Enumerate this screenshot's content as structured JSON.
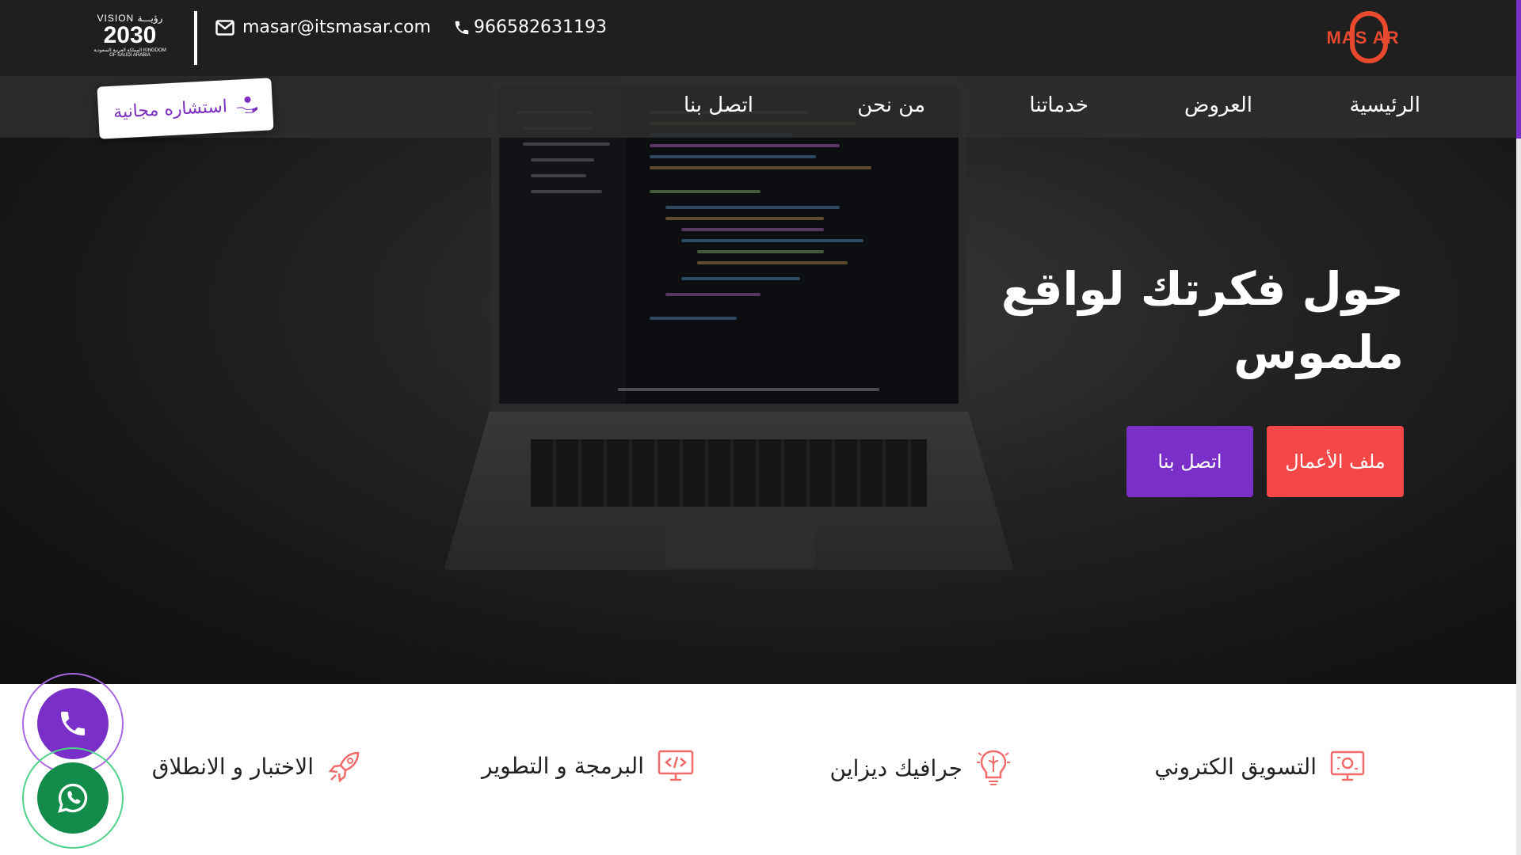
{
  "header": {
    "logo_text": "MAS AR",
    "phone": "966582631193",
    "email": "masar@itsmasar.com",
    "vision": {
      "line1": "VISION رؤيـــة",
      "line2": "2030",
      "line3": "المملكة العربية السعودية KINGDOM OF SAUDI ARABIA"
    }
  },
  "nav": {
    "items": [
      {
        "label": "الرئيسية"
      },
      {
        "label": "العروض"
      },
      {
        "label": "خدماتنا"
      },
      {
        "label": "من نحن"
      },
      {
        "label": "اتصل بنا"
      }
    ],
    "consult_label": "استشاره مجانية"
  },
  "hero": {
    "title": "حول فكرتك لواقع ملموس",
    "buttons": {
      "portfolio": "ملف الأعمال",
      "contact": "اتصل بنا"
    }
  },
  "services": [
    {
      "label": "التسويق الكتروني",
      "icon": "marketing-monitor-icon"
    },
    {
      "label": "جرافيك ديزاين",
      "icon": "brain-bulb-icon"
    },
    {
      "label": "البرمجة و التطوير",
      "icon": "code-monitor-icon"
    },
    {
      "label": "الاختبار و الانطلاق",
      "icon": "rocket-icon"
    }
  ],
  "floating": {
    "call_icon": "phone-icon",
    "whatsapp_icon": "whatsapp-icon"
  },
  "colors": {
    "accent": "#7a2fc8",
    "brand": "#e8492f",
    "portfolio": "#f44848",
    "whatsapp": "#128c4a"
  }
}
